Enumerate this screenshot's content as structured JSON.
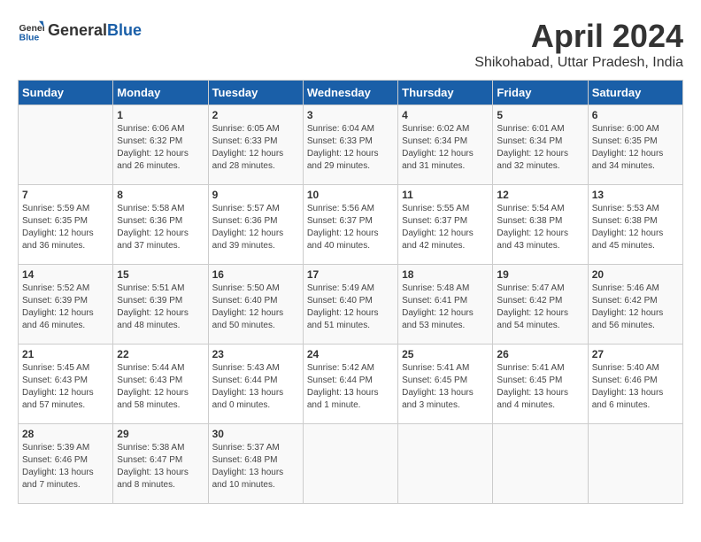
{
  "header": {
    "logo_general": "General",
    "logo_blue": "Blue",
    "title": "April 2024",
    "subtitle": "Shikohabad, Uttar Pradesh, India"
  },
  "calendar": {
    "days_of_week": [
      "Sunday",
      "Monday",
      "Tuesday",
      "Wednesday",
      "Thursday",
      "Friday",
      "Saturday"
    ],
    "weeks": [
      [
        {
          "day": "",
          "info": ""
        },
        {
          "day": "1",
          "info": "Sunrise: 6:06 AM\nSunset: 6:32 PM\nDaylight: 12 hours\nand 26 minutes."
        },
        {
          "day": "2",
          "info": "Sunrise: 6:05 AM\nSunset: 6:33 PM\nDaylight: 12 hours\nand 28 minutes."
        },
        {
          "day": "3",
          "info": "Sunrise: 6:04 AM\nSunset: 6:33 PM\nDaylight: 12 hours\nand 29 minutes."
        },
        {
          "day": "4",
          "info": "Sunrise: 6:02 AM\nSunset: 6:34 PM\nDaylight: 12 hours\nand 31 minutes."
        },
        {
          "day": "5",
          "info": "Sunrise: 6:01 AM\nSunset: 6:34 PM\nDaylight: 12 hours\nand 32 minutes."
        },
        {
          "day": "6",
          "info": "Sunrise: 6:00 AM\nSunset: 6:35 PM\nDaylight: 12 hours\nand 34 minutes."
        }
      ],
      [
        {
          "day": "7",
          "info": "Sunrise: 5:59 AM\nSunset: 6:35 PM\nDaylight: 12 hours\nand 36 minutes."
        },
        {
          "day": "8",
          "info": "Sunrise: 5:58 AM\nSunset: 6:36 PM\nDaylight: 12 hours\nand 37 minutes."
        },
        {
          "day": "9",
          "info": "Sunrise: 5:57 AM\nSunset: 6:36 PM\nDaylight: 12 hours\nand 39 minutes."
        },
        {
          "day": "10",
          "info": "Sunrise: 5:56 AM\nSunset: 6:37 PM\nDaylight: 12 hours\nand 40 minutes."
        },
        {
          "day": "11",
          "info": "Sunrise: 5:55 AM\nSunset: 6:37 PM\nDaylight: 12 hours\nand 42 minutes."
        },
        {
          "day": "12",
          "info": "Sunrise: 5:54 AM\nSunset: 6:38 PM\nDaylight: 12 hours\nand 43 minutes."
        },
        {
          "day": "13",
          "info": "Sunrise: 5:53 AM\nSunset: 6:38 PM\nDaylight: 12 hours\nand 45 minutes."
        }
      ],
      [
        {
          "day": "14",
          "info": "Sunrise: 5:52 AM\nSunset: 6:39 PM\nDaylight: 12 hours\nand 46 minutes."
        },
        {
          "day": "15",
          "info": "Sunrise: 5:51 AM\nSunset: 6:39 PM\nDaylight: 12 hours\nand 48 minutes."
        },
        {
          "day": "16",
          "info": "Sunrise: 5:50 AM\nSunset: 6:40 PM\nDaylight: 12 hours\nand 50 minutes."
        },
        {
          "day": "17",
          "info": "Sunrise: 5:49 AM\nSunset: 6:40 PM\nDaylight: 12 hours\nand 51 minutes."
        },
        {
          "day": "18",
          "info": "Sunrise: 5:48 AM\nSunset: 6:41 PM\nDaylight: 12 hours\nand 53 minutes."
        },
        {
          "day": "19",
          "info": "Sunrise: 5:47 AM\nSunset: 6:42 PM\nDaylight: 12 hours\nand 54 minutes."
        },
        {
          "day": "20",
          "info": "Sunrise: 5:46 AM\nSunset: 6:42 PM\nDaylight: 12 hours\nand 56 minutes."
        }
      ],
      [
        {
          "day": "21",
          "info": "Sunrise: 5:45 AM\nSunset: 6:43 PM\nDaylight: 12 hours\nand 57 minutes."
        },
        {
          "day": "22",
          "info": "Sunrise: 5:44 AM\nSunset: 6:43 PM\nDaylight: 12 hours\nand 58 minutes."
        },
        {
          "day": "23",
          "info": "Sunrise: 5:43 AM\nSunset: 6:44 PM\nDaylight: 13 hours\nand 0 minutes."
        },
        {
          "day": "24",
          "info": "Sunrise: 5:42 AM\nSunset: 6:44 PM\nDaylight: 13 hours\nand 1 minute."
        },
        {
          "day": "25",
          "info": "Sunrise: 5:41 AM\nSunset: 6:45 PM\nDaylight: 13 hours\nand 3 minutes."
        },
        {
          "day": "26",
          "info": "Sunrise: 5:41 AM\nSunset: 6:45 PM\nDaylight: 13 hours\nand 4 minutes."
        },
        {
          "day": "27",
          "info": "Sunrise: 5:40 AM\nSunset: 6:46 PM\nDaylight: 13 hours\nand 6 minutes."
        }
      ],
      [
        {
          "day": "28",
          "info": "Sunrise: 5:39 AM\nSunset: 6:46 PM\nDaylight: 13 hours\nand 7 minutes."
        },
        {
          "day": "29",
          "info": "Sunrise: 5:38 AM\nSunset: 6:47 PM\nDaylight: 13 hours\nand 8 minutes."
        },
        {
          "day": "30",
          "info": "Sunrise: 5:37 AM\nSunset: 6:48 PM\nDaylight: 13 hours\nand 10 minutes."
        },
        {
          "day": "",
          "info": ""
        },
        {
          "day": "",
          "info": ""
        },
        {
          "day": "",
          "info": ""
        },
        {
          "day": "",
          "info": ""
        }
      ]
    ]
  }
}
